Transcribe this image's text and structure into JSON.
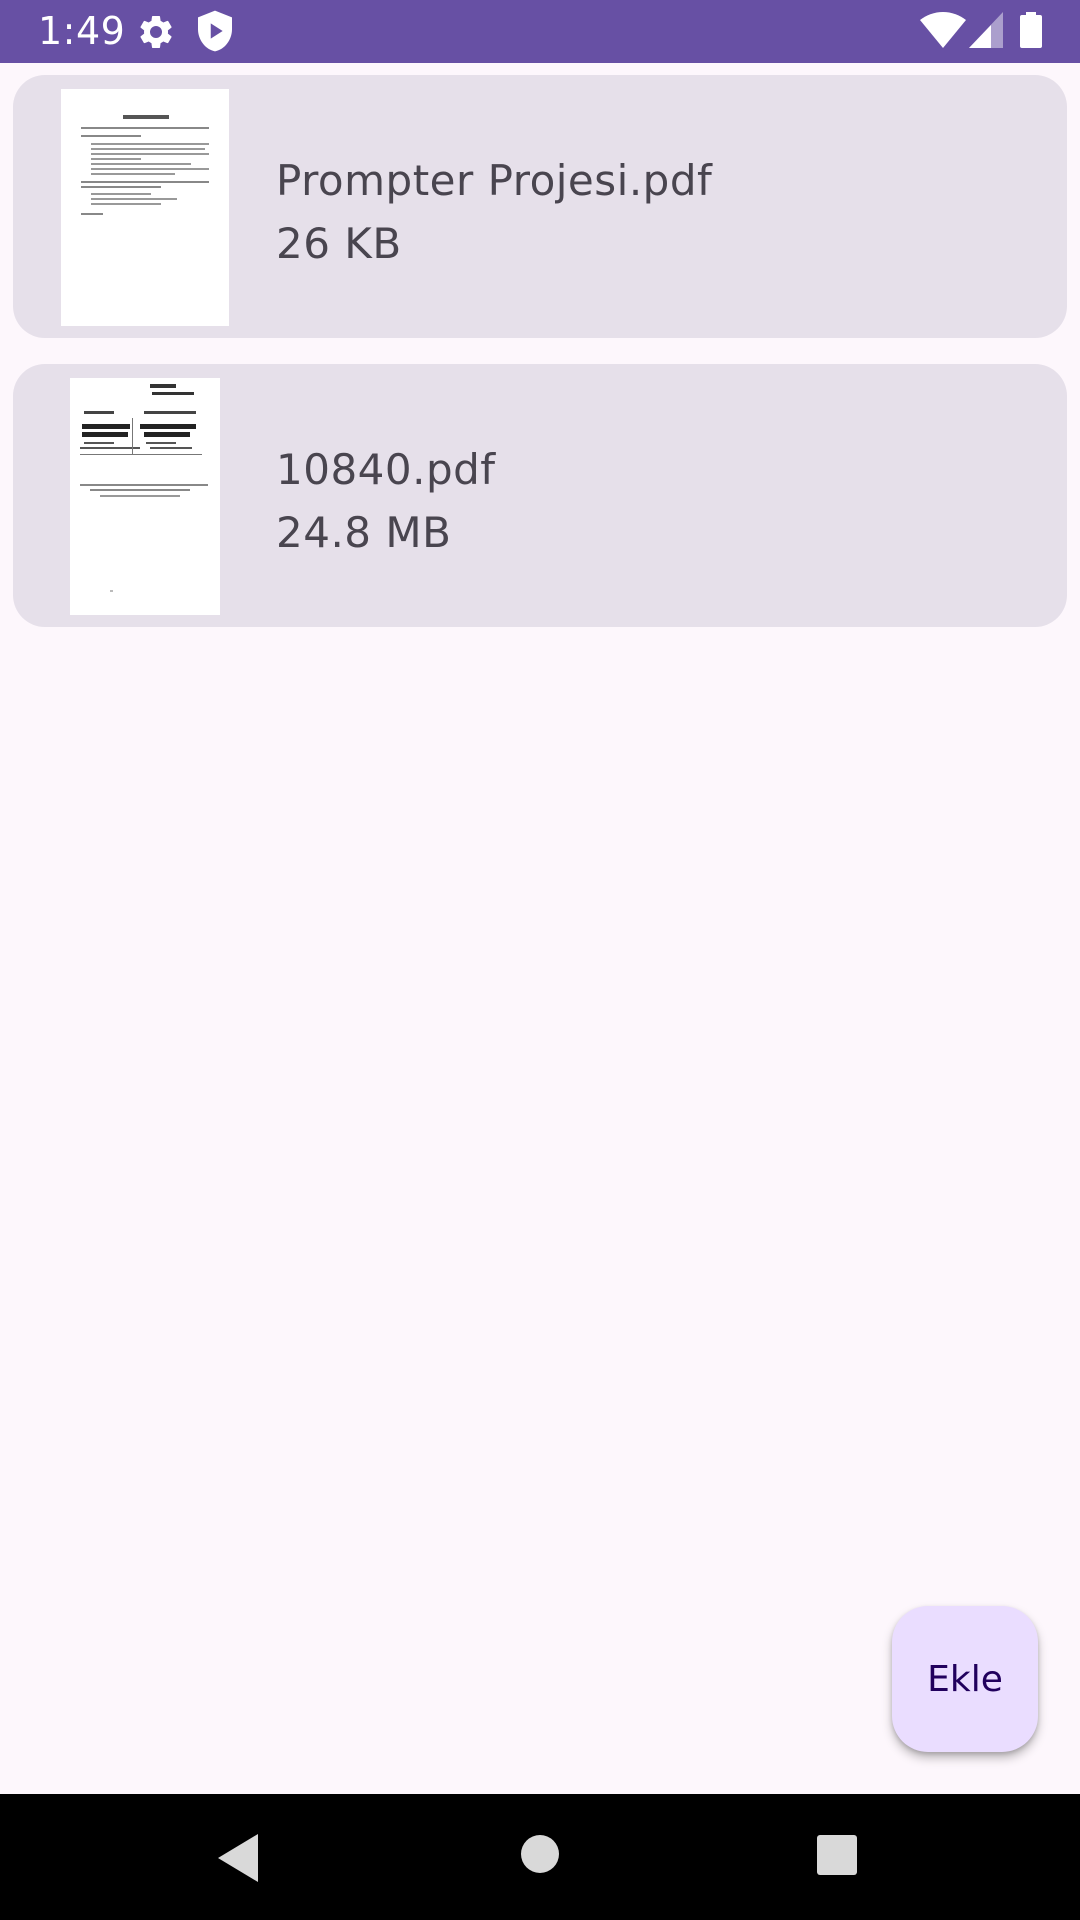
{
  "status_bar": {
    "time": "1:49",
    "icons": [
      "gear-icon",
      "shield-play-icon",
      "wifi-icon",
      "signal-icon",
      "battery-icon"
    ],
    "background": "#6750a4"
  },
  "files": [
    {
      "name": "Prompter Projesi.pdf",
      "size": "26 KB",
      "thumbnail_icon": "pdf-page-thumbnail"
    },
    {
      "name": "10840.pdf",
      "size": "24.8 MB",
      "thumbnail_icon": "pdf-page-thumbnail"
    }
  ],
  "fab": {
    "label": "Ekle",
    "color": "#eaddff"
  },
  "nav_bar": {
    "icons": [
      "back-icon",
      "home-icon",
      "recents-icon"
    ]
  },
  "colors": {
    "card": "#e6e0ea",
    "background": "#fdf7fc",
    "text": "#49454f"
  }
}
